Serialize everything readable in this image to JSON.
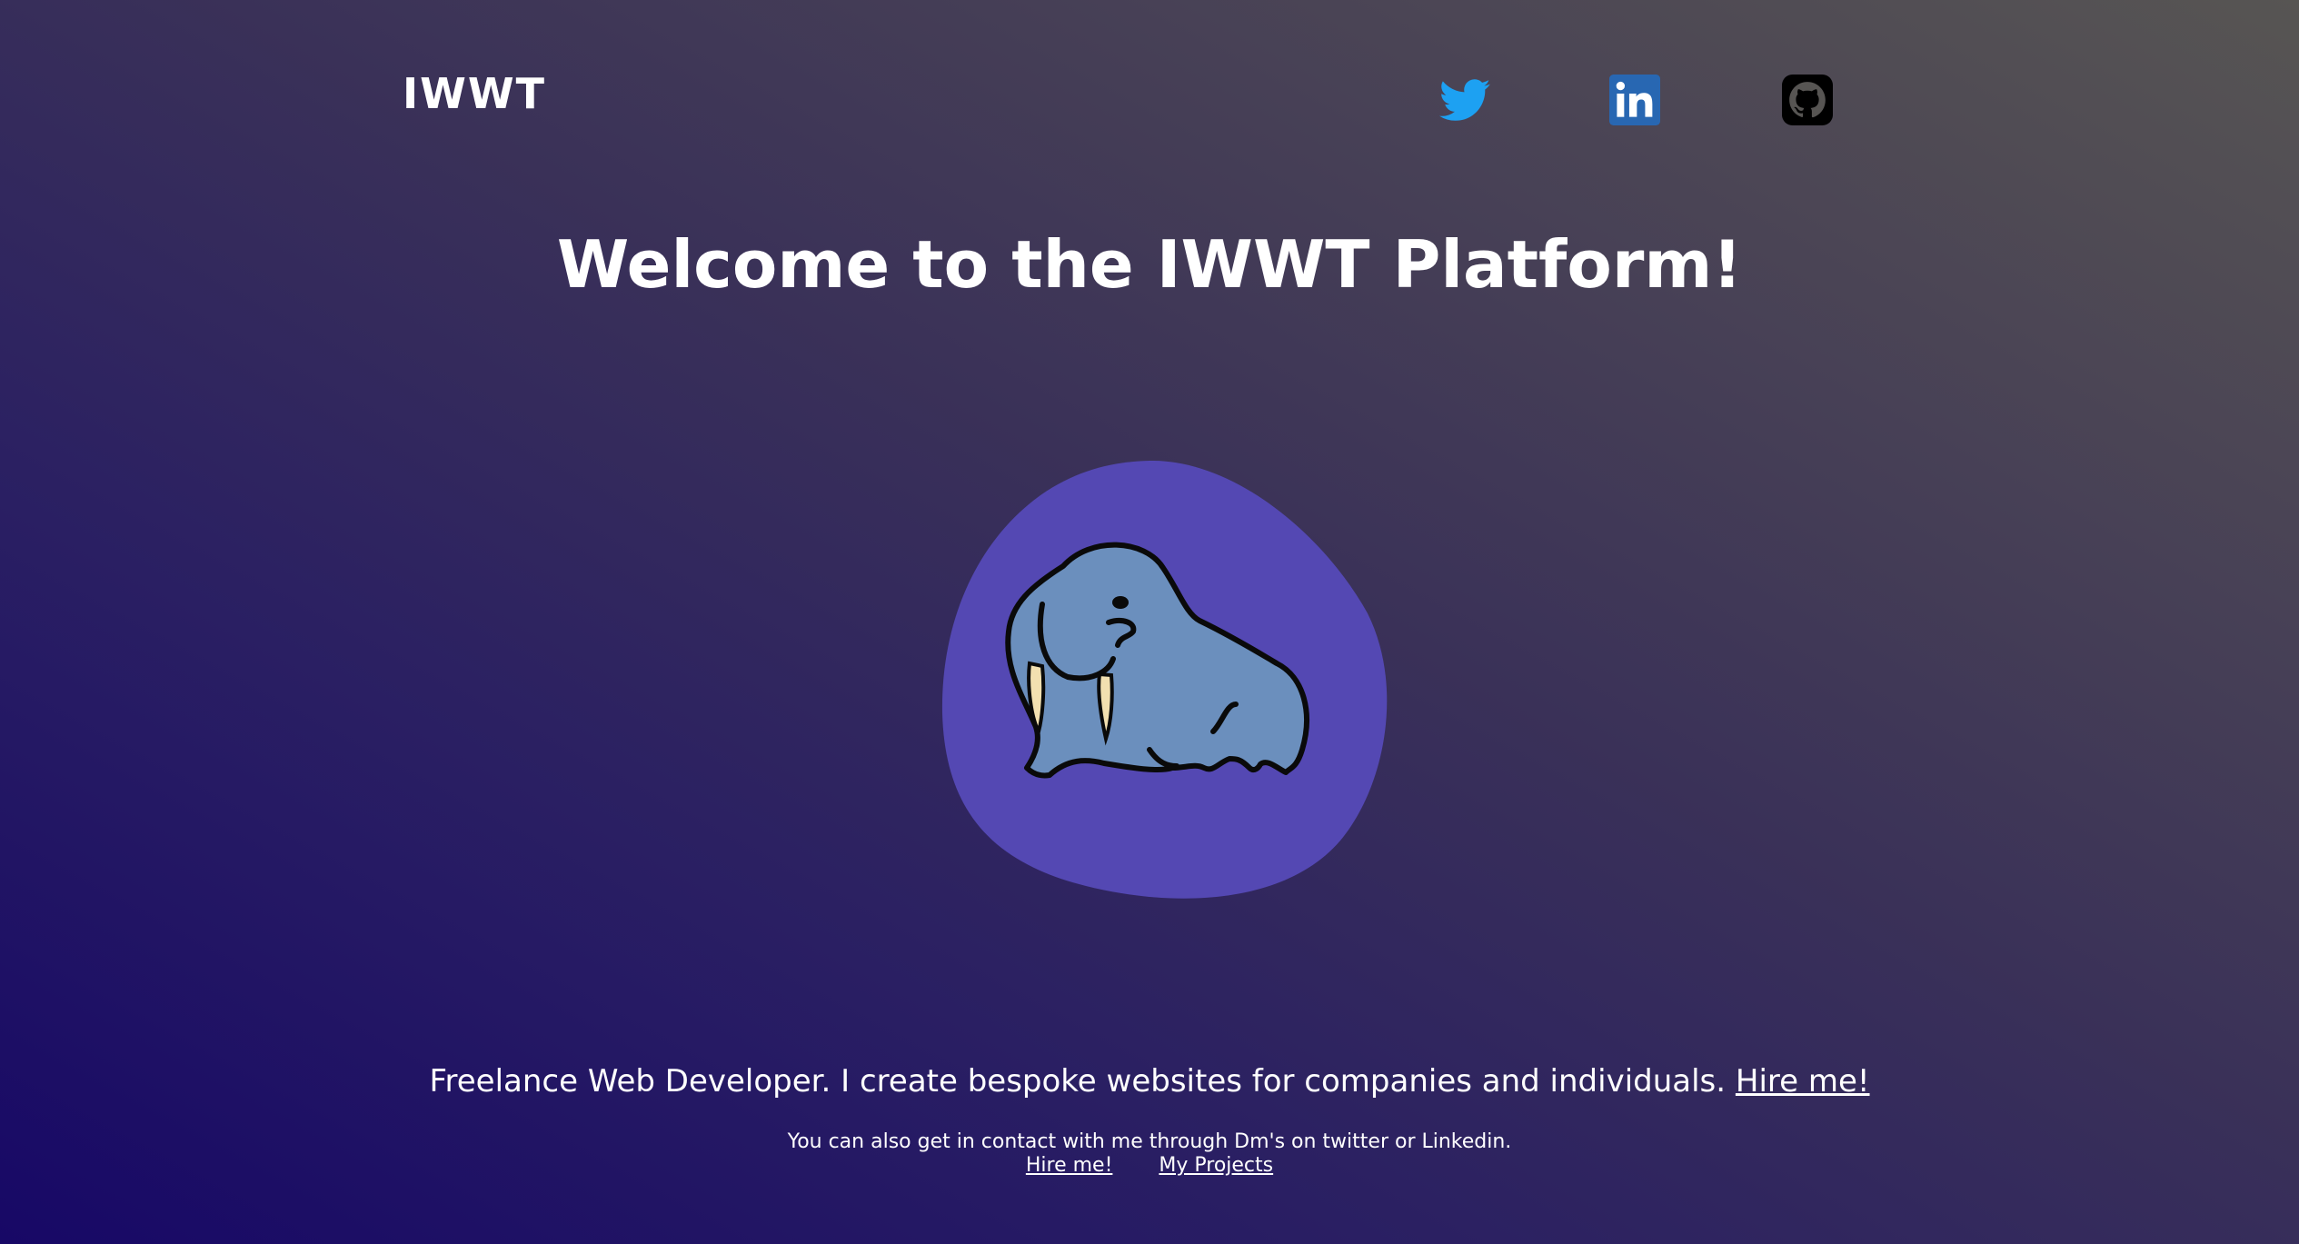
{
  "header": {
    "brand": "IWWT",
    "social": [
      {
        "icon": "twitter-icon",
        "color": "#1da1f2"
      },
      {
        "icon": "linkedin-icon",
        "color": "#2867b2"
      },
      {
        "icon": "github-icon",
        "color": "#000000"
      }
    ]
  },
  "main": {
    "title": "Welcome to the IWWT Platform!",
    "hero_image": "walrus-illustration",
    "blob_color": "#5448b3",
    "walrus_color": "#6b8fbd"
  },
  "footer": {
    "tagline": "Freelance Web Developer. I create bespoke websites for companies and individuals.",
    "tagline_link": "Hire me!",
    "contact_text": "You can also get in contact with me through Dm's on twitter or Linkedin.",
    "links": [
      "Hire me!",
      "My Projects"
    ]
  },
  "colors": {
    "gradient_start": "#170866",
    "gradient_end": "#575553",
    "text": "#ffffff"
  }
}
